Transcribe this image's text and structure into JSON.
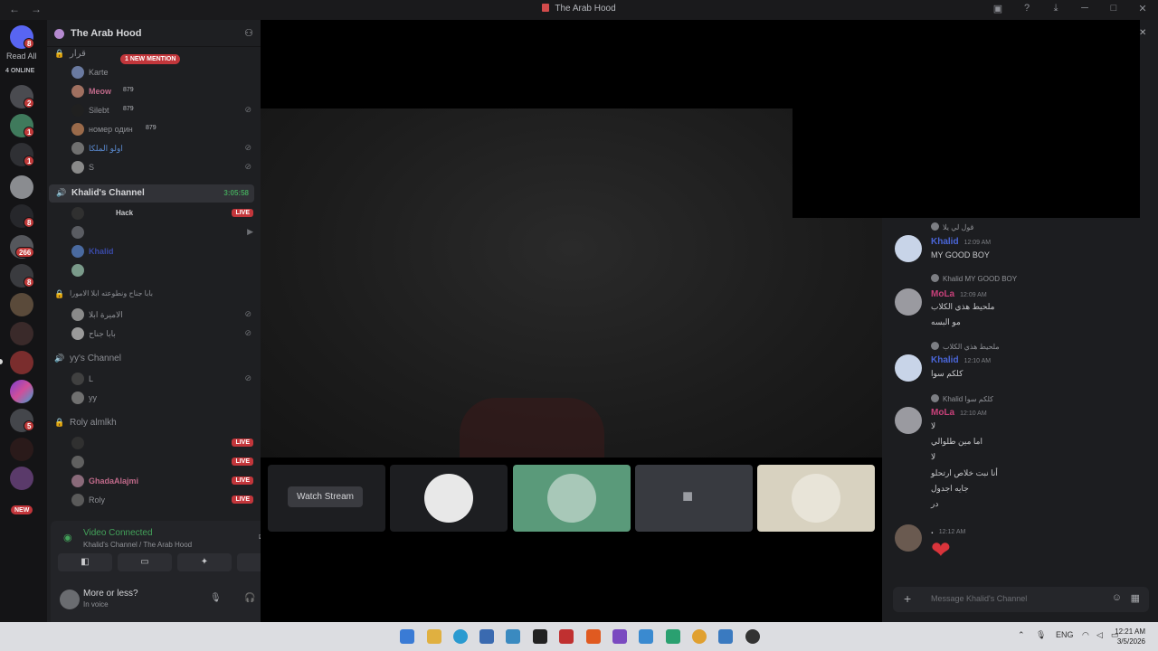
{
  "window": {
    "title": "The Arab Hood",
    "nav_back": "←",
    "nav_forward": "→"
  },
  "guild_bar": {
    "read_all": "Read All",
    "online": "4 ONLINE",
    "new_label": "NEW",
    "badges": [
      "8",
      "2",
      "1",
      "1",
      "8",
      "266",
      "8",
      "5"
    ]
  },
  "server": {
    "name": "The Arab Hood",
    "new_mention": "1 NEW MENTION",
    "top_channel": "قرار",
    "top_members": [
      {
        "name": "Karte",
        "extra": ""
      },
      {
        "name": "Meow",
        "extra": "879"
      },
      {
        "name": "Silebt",
        "extra": "879"
      },
      {
        "name": "номер один",
        "extra": "879"
      },
      {
        "name": "اولو الملكا",
        "extra": ""
      },
      {
        "name": "S",
        "extra": ""
      }
    ],
    "active_channel": {
      "name": "Khalid's Channel",
      "timer": "3:05:58"
    },
    "active_members": [
      {
        "name": "Hack",
        "live": "LIVE"
      },
      {
        "name": "",
        "live": ""
      },
      {
        "name": "Khalid",
        "live": ""
      },
      {
        "name": "",
        "live": ""
      }
    ],
    "locked_channel": "بابا جناح ونطوعته ابلا الامورا",
    "locked_members": [
      "الاميرة ابلا",
      "بابا جناح"
    ],
    "yy_channel": "yy's Channel",
    "yy_members": [
      "L",
      "yy"
    ],
    "roly_channel": "Roly almlkh",
    "roly_members": [
      {
        "name": "",
        "live": "LIVE"
      },
      {
        "name": "",
        "live": "LIVE"
      },
      {
        "name": "GhadaAlajmi",
        "live": "LIVE"
      },
      {
        "name": "Roly",
        "live": "LIVE"
      }
    ]
  },
  "voice": {
    "status": "Video Connected",
    "location": "Khalid's Channel / The Arab Hood"
  },
  "user": {
    "name": "More or less?",
    "status": "In voice"
  },
  "stage": {
    "watch_stream": "Watch Stream"
  },
  "chat": {
    "messages": [
      {
        "reply": "قول لي يلا",
        "author": "Khalid",
        "author_color": "#4a66d9",
        "time": "12:09 AM",
        "lines": [
          "MY GOOD BOY"
        ]
      },
      {
        "reply": "Khalid MY GOOD BOY",
        "author": "MoLa",
        "author_color": "#c8417a",
        "time": "12:09 AM",
        "lines": [
          "ملحيط هذي الكلاب",
          "مو البسه"
        ]
      },
      {
        "reply": "ملحيط هذي الكلاب",
        "author": "Khalid",
        "author_color": "#4a66d9",
        "time": "12:10 AM",
        "lines": [
          "كلكم سوا"
        ]
      },
      {
        "reply": "Khalid كلكم سوا",
        "author": "MoLa",
        "author_color": "#c8417a",
        "time": "12:10 AM",
        "lines": [
          "لا",
          "اما مين طلوالي",
          "لا",
          "أنا نبت خلاص ارتحلو",
          "جايه اجدول",
          "در"
        ]
      },
      {
        "reply": "",
        "author": ".",
        "author_color": "#c9cacd",
        "time": "12:12 AM",
        "lines": []
      }
    ],
    "heart": "❤",
    "composer_placeholder": "Message Khalid's Channel"
  },
  "taskbar": {
    "lang": "ENG",
    "time": "12:21 AM",
    "date": "3/5/2026"
  }
}
